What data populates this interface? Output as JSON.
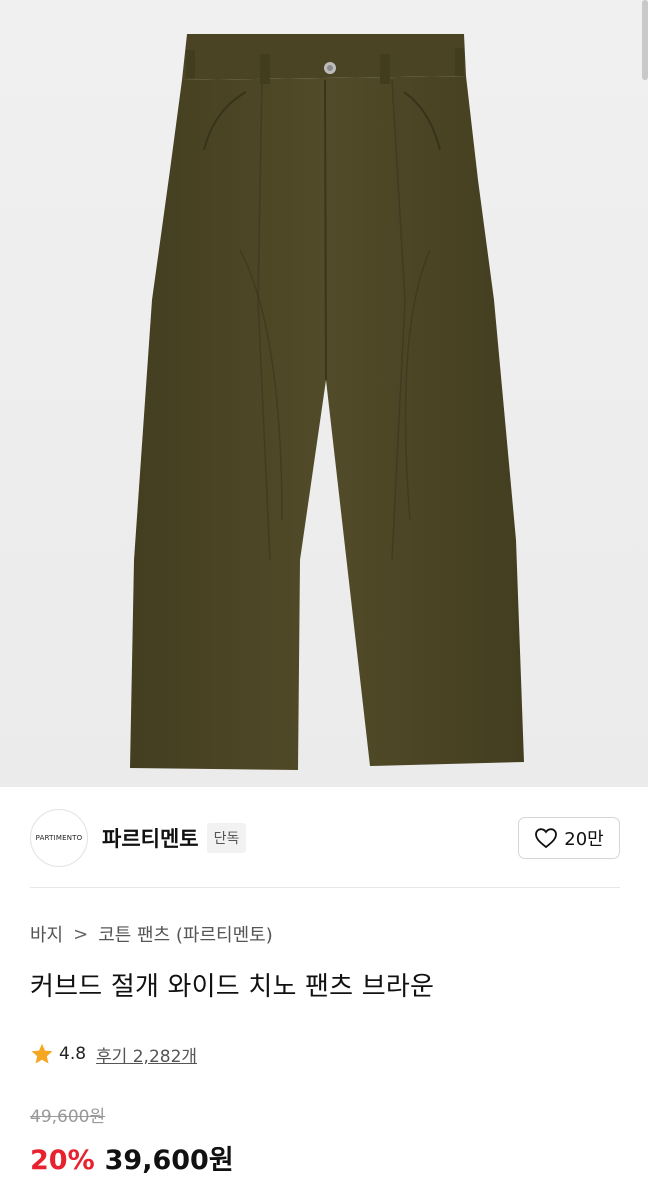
{
  "product_image": {
    "alt": "",
    "color": "#4e4826"
  },
  "brand": {
    "logo_text": "PARTIMENTO",
    "name": "파르티멘토",
    "badge": "단독"
  },
  "like": {
    "count": "20만",
    "icon": "heart-outline-icon"
  },
  "breadcrumb": {
    "items": [
      "바지",
      "코튼 팬츠 (파르티멘토)"
    ],
    "separator": ">"
  },
  "product": {
    "title": "커브드 절개 와이드 치노 팬츠 브라운"
  },
  "rating": {
    "icon": "star-icon",
    "score": "4.8",
    "reviews": "후기 2,282개",
    "star_color": "#f5a623"
  },
  "price": {
    "original": "49,600원",
    "discount": "20%",
    "sale": "39,600원",
    "discount_color": "#e8212e"
  }
}
